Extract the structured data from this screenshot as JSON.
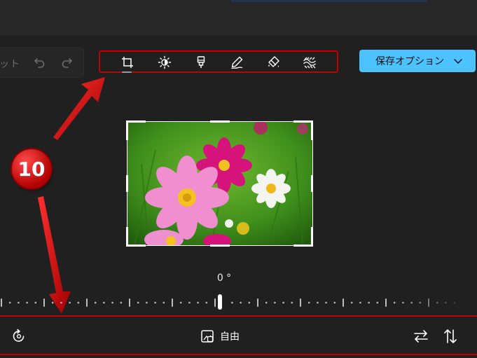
{
  "toolbar": {
    "reset_label": "ット",
    "tools": [
      {
        "icon": "crop-icon",
        "name": "crop"
      },
      {
        "icon": "brightness-icon",
        "name": "adjust"
      },
      {
        "icon": "filter-icon",
        "name": "filter"
      },
      {
        "icon": "markup-icon",
        "name": "markup"
      },
      {
        "icon": "retouch-icon",
        "name": "retouch"
      },
      {
        "icon": "background-icon",
        "name": "background"
      }
    ],
    "save_label": "保存オプション"
  },
  "callout": {
    "number": "10"
  },
  "crop": {
    "angle_label": "0 °",
    "aspect_label": "自由"
  },
  "colors": {
    "accent": "#4cc2ff",
    "annotation": "#c50000",
    "background": "#202020"
  }
}
